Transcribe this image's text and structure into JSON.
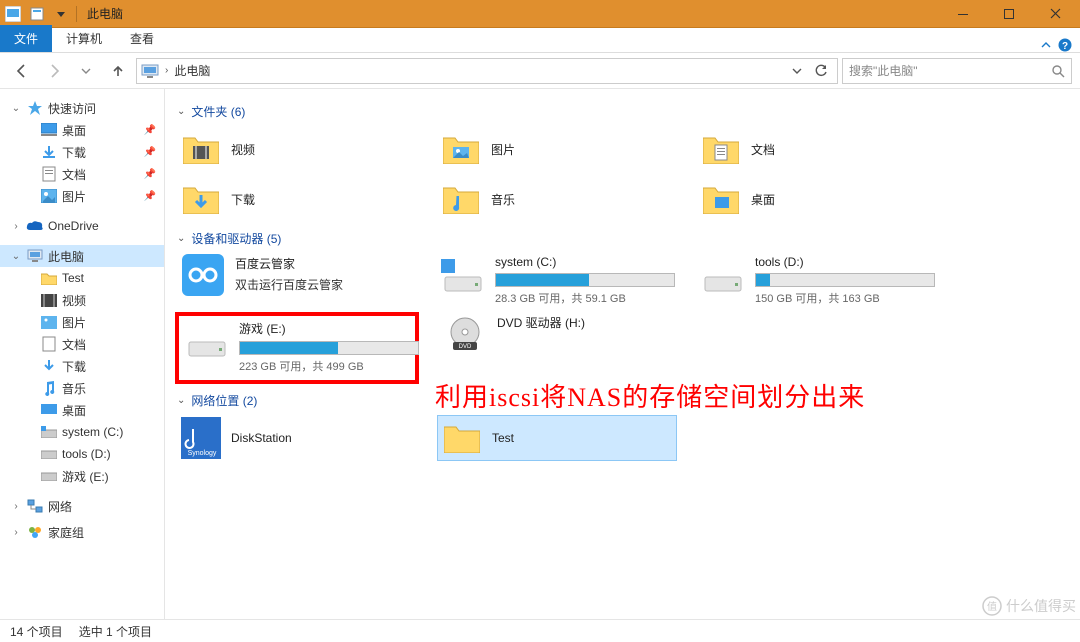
{
  "window": {
    "title": "此电脑"
  },
  "ribbon": {
    "file": "文件",
    "computer": "计算机",
    "view": "查看"
  },
  "nav": {
    "breadcrumb": "此电脑",
    "search_placeholder": "搜索\"此电脑\""
  },
  "sidebar": {
    "quick_access": "快速访问",
    "quick_items": [
      {
        "label": "桌面",
        "pinned": true
      },
      {
        "label": "下载",
        "pinned": true
      },
      {
        "label": "文档",
        "pinned": true
      },
      {
        "label": "图片",
        "pinned": true
      }
    ],
    "onedrive": "OneDrive",
    "this_pc": "此电脑",
    "pc_items": [
      {
        "label": "Test"
      },
      {
        "label": "视频"
      },
      {
        "label": "图片"
      },
      {
        "label": "文档"
      },
      {
        "label": "下载"
      },
      {
        "label": "音乐"
      },
      {
        "label": "桌面"
      },
      {
        "label": "system (C:)"
      },
      {
        "label": "tools (D:)"
      },
      {
        "label": "游戏 (E:)"
      }
    ],
    "network": "网络",
    "homegroup": "家庭组"
  },
  "groups": {
    "folders_header": "文件夹 (6)",
    "devices_header": "设备和驱动器 (5)",
    "netloc_header": "网络位置 (2)"
  },
  "folders": [
    {
      "label": "视频",
      "kind": "video"
    },
    {
      "label": "图片",
      "kind": "pictures"
    },
    {
      "label": "文档",
      "kind": "documents"
    },
    {
      "label": "下载",
      "kind": "downloads"
    },
    {
      "label": "音乐",
      "kind": "music"
    },
    {
      "label": "桌面",
      "kind": "desktop"
    }
  ],
  "devices": {
    "baidu": {
      "name": "百度云管家",
      "sub": "双击运行百度云管家"
    },
    "c": {
      "name": "system (C:)",
      "info": "28.3 GB 可用，共 59.1 GB",
      "pct": 52
    },
    "d": {
      "name": "tools (D:)",
      "info": "150 GB 可用，共 163 GB",
      "pct": 8
    },
    "e": {
      "name": "游戏 (E:)",
      "info": "223 GB 可用，共 499 GB",
      "pct": 55
    },
    "h": {
      "name": "DVD 驱动器 (H:)"
    }
  },
  "netloc": {
    "diskstation": "DiskStation",
    "test": "Test"
  },
  "annotation": "利用iscsi将NAS的存储空间划分出来",
  "status": {
    "items": "14 个项目",
    "selected": "选中 1 个项目"
  },
  "watermark": "什么值得买"
}
